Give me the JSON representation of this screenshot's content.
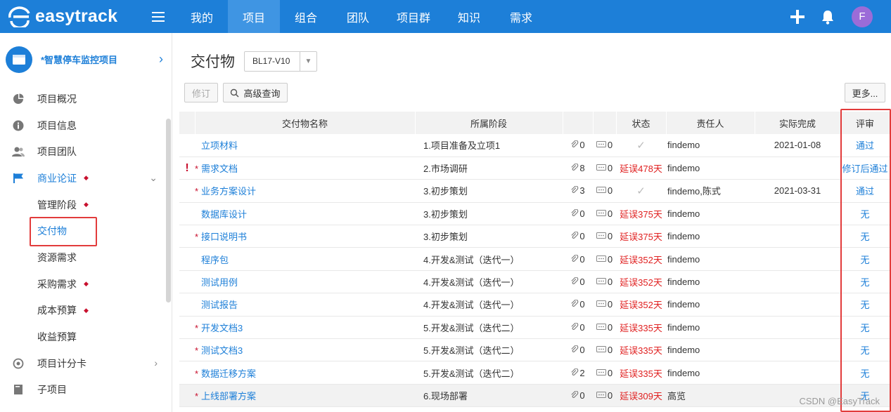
{
  "brand": {
    "name": "easytrack"
  },
  "nav": {
    "items": [
      {
        "label": "我的",
        "active": false
      },
      {
        "label": "项目",
        "active": true
      },
      {
        "label": "组合",
        "active": false
      },
      {
        "label": "团队",
        "active": false
      },
      {
        "label": "项目群",
        "active": false
      },
      {
        "label": "知识",
        "active": false
      },
      {
        "label": "需求",
        "active": false
      }
    ],
    "user_initial": "F"
  },
  "sidebar": {
    "project_name": "*智慧停车监控项目",
    "items": [
      {
        "label": "项目概况",
        "icon": "pie-chart-icon"
      },
      {
        "label": "项目信息",
        "icon": "info-icon"
      },
      {
        "label": "项目团队",
        "icon": "team-icon"
      },
      {
        "label": "商业论证",
        "icon": "flag-icon",
        "marked": true,
        "expanded": true
      },
      {
        "label": "项目计分卡",
        "icon": "target-icon"
      },
      {
        "label": "子项目",
        "icon": "document-icon"
      }
    ],
    "subitems": [
      {
        "label": "管理阶段",
        "marked": true
      },
      {
        "label": "交付物",
        "marked": false,
        "active": true
      },
      {
        "label": "资源需求",
        "marked": false
      },
      {
        "label": "采购需求",
        "marked": true
      },
      {
        "label": "成本预算",
        "marked": true
      },
      {
        "label": "收益预算",
        "marked": false
      }
    ]
  },
  "page": {
    "title": "交付物",
    "version": "BL17-V10",
    "revise_button": "修订",
    "search_button": "高级查询",
    "more_button": "更多..."
  },
  "table": {
    "headers": {
      "name": "交付物名称",
      "stage": "所属阶段",
      "status": "状态",
      "owner": "责任人",
      "done": "实际完成",
      "review": "评审"
    },
    "rows": [
      {
        "flag": "",
        "required": false,
        "name": "立项材料",
        "stage": "1.项目准备及立项1",
        "attachments": "0",
        "comments": "0",
        "status": "✓",
        "status_late": false,
        "owner": "findemo",
        "done": "2021-01-08",
        "review": "通过"
      },
      {
        "flag": "!",
        "required": true,
        "name": "需求文档",
        "stage": "2.市场调研",
        "attachments": "8",
        "comments": "0",
        "status": "延误478天",
        "status_late": true,
        "owner": "findemo",
        "done": "",
        "review": "修订后通过"
      },
      {
        "flag": "",
        "required": true,
        "name": "业务方案设计",
        "stage": "3.初步策划",
        "attachments": "3",
        "comments": "0",
        "status": "✓",
        "status_late": false,
        "owner": "findemo,陈式",
        "done": "2021-03-31",
        "review": "通过"
      },
      {
        "flag": "",
        "required": false,
        "name": "数据库设计",
        "stage": "3.初步策划",
        "attachments": "0",
        "comments": "0",
        "status": "延误375天",
        "status_late": true,
        "owner": "findemo",
        "done": "",
        "review": "无"
      },
      {
        "flag": "",
        "required": true,
        "name": "接口说明书",
        "stage": "3.初步策划",
        "attachments": "0",
        "comments": "0",
        "status": "延误375天",
        "status_late": true,
        "owner": "findemo",
        "done": "",
        "review": "无"
      },
      {
        "flag": "",
        "required": false,
        "name": "程序包",
        "stage": "4.开发&测试（迭代一）",
        "attachments": "0",
        "comments": "0",
        "status": "延误352天",
        "status_late": true,
        "owner": "findemo",
        "done": "",
        "review": "无"
      },
      {
        "flag": "",
        "required": false,
        "name": "测试用例",
        "stage": "4.开发&测试（迭代一）",
        "attachments": "0",
        "comments": "0",
        "status": "延误352天",
        "status_late": true,
        "owner": "findemo",
        "done": "",
        "review": "无"
      },
      {
        "flag": "",
        "required": false,
        "name": "测试报告",
        "stage": "4.开发&测试（迭代一）",
        "attachments": "0",
        "comments": "0",
        "status": "延误352天",
        "status_late": true,
        "owner": "findemo",
        "done": "",
        "review": "无"
      },
      {
        "flag": "",
        "required": true,
        "name": "开发文档3",
        "stage": "5.开发&测试（迭代二）",
        "attachments": "0",
        "comments": "0",
        "status": "延误335天",
        "status_late": true,
        "owner": "findemo",
        "done": "",
        "review": "无"
      },
      {
        "flag": "",
        "required": true,
        "name": "测试文档3",
        "stage": "5.开发&测试（迭代二）",
        "attachments": "0",
        "comments": "0",
        "status": "延误335天",
        "status_late": true,
        "owner": "findemo",
        "done": "",
        "review": "无"
      },
      {
        "flag": "",
        "required": true,
        "name": "数据迁移方案",
        "stage": "5.开发&测试（迭代二）",
        "attachments": "2",
        "comments": "0",
        "status": "延误335天",
        "status_late": true,
        "owner": "findemo",
        "done": "",
        "review": "无"
      },
      {
        "flag": "",
        "required": true,
        "name": "上线部署方案",
        "stage": "6.现场部署",
        "attachments": "0",
        "comments": "0",
        "status": "延误309天",
        "status_late": true,
        "owner": "高览",
        "done": "",
        "review": "无"
      }
    ]
  },
  "watermark": "CSDN @EasyTrack",
  "colors": {
    "primary": "#1d7fd8",
    "late": "#e02020",
    "highlight_box": "#e23b3b"
  }
}
